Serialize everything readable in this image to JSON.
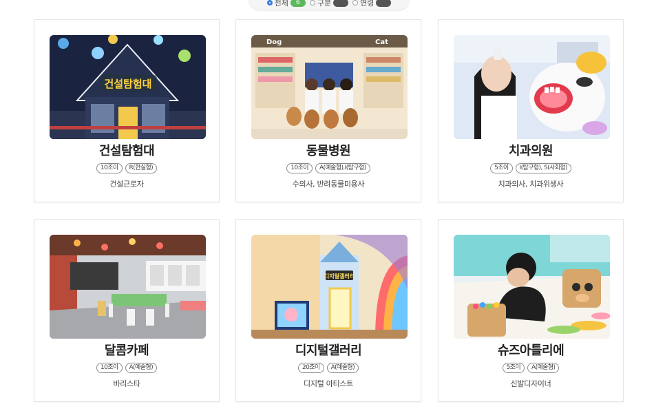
{
  "filters": [
    {
      "label": "전체",
      "count": "6",
      "selected": true
    },
    {
      "label": "구분",
      "count": "",
      "selected": false
    },
    {
      "label": "연령",
      "count": "",
      "selected": false
    }
  ],
  "cards": [
    {
      "title": "건설탐험대",
      "tags": [
        "10조이",
        "R(현실형)"
      ],
      "job": "건설근로자",
      "image_label": "건설탐험대"
    },
    {
      "title": "동물병원",
      "tags": [
        "10조이",
        "A(예술형),I(탐구형)"
      ],
      "job": "수의사, 반려동물미용사",
      "image_label_left": "Dog",
      "image_label_right": "Cat"
    },
    {
      "title": "치과의원",
      "tags": [
        "5조이",
        "I(탐구형), S(사회형)"
      ],
      "job": "치과의사, 치과위생사"
    },
    {
      "title": "달콤카페",
      "tags": [
        "10조이",
        "A(예술형)"
      ],
      "job": "바리스타"
    },
    {
      "title": "디지털갤러리",
      "tags": [
        "20조이",
        "A(예술형)"
      ],
      "job": "디지털 아티스트",
      "image_label": "디지털갤러리"
    },
    {
      "title": "슈즈아틀리에",
      "tags": [
        "5조이",
        "A(예술형)"
      ],
      "job": "신발디자이너"
    }
  ]
}
